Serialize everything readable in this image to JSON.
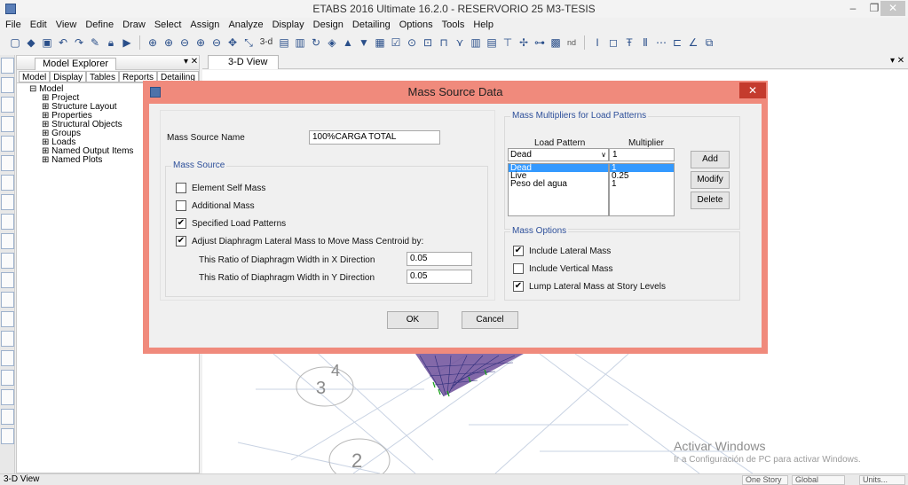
{
  "window": {
    "title": "ETABS 2016 Ultimate 16.2.0 - RESERVORIO 25 M3-TESIS",
    "minimize": "–",
    "maximize": "❐",
    "close": "✕"
  },
  "menu": [
    "File",
    "Edit",
    "View",
    "Define",
    "Draw",
    "Select",
    "Assign",
    "Analyze",
    "Display",
    "Design",
    "Detailing",
    "Options",
    "Tools",
    "Help"
  ],
  "toolbar": {
    "threed_label": "3-d",
    "nd_label": "nd"
  },
  "explorer": {
    "title": "Model Explorer",
    "pin": "▾ ✕",
    "tabs": [
      "Model",
      "Display",
      "Tables",
      "Reports",
      "Detailing"
    ],
    "tree": {
      "root": "Model",
      "children": [
        "Project",
        "Structure Layout",
        "Properties",
        "Structural Objects",
        "Groups",
        "Loads",
        "Named Output Items",
        "Named Plots"
      ]
    }
  },
  "view_tab": {
    "label": "3-D View",
    "controls": "▾ ✕"
  },
  "canvas": {
    "labels": [
      "3",
      "4",
      "2"
    ]
  },
  "dialog": {
    "title": "Mass Source Data",
    "close": "✕",
    "mass_source_name_label": "Mass Source Name",
    "mass_source_name_value": "100%CARGA TOTAL",
    "mass_source_group": "Mass Source",
    "element_self_mass": {
      "label": "Element Self Mass",
      "checked": false
    },
    "additional_mass": {
      "label": "Additional Mass",
      "checked": false
    },
    "specified_load_patterns": {
      "label": "Specified Load Patterns",
      "checked": true
    },
    "adjust_diaphragm": {
      "label": "Adjust Diaphragm Lateral Mass to Move Mass Centroid by:",
      "checked": true
    },
    "ratio_x_label": "This Ratio of Diaphragm Width in X Direction",
    "ratio_x_value": "0.05",
    "ratio_y_label": "This Ratio of Diaphragm Width in Y Direction",
    "ratio_y_value": "0.05",
    "multipliers_group": "Mass Multipliers for Load Patterns",
    "load_pattern_header": "Load Pattern",
    "multiplier_header": "Multiplier",
    "load_pattern_selected": "Dead",
    "multiplier_value": "1",
    "patterns": [
      "Dead",
      "Live",
      "Peso del agua"
    ],
    "multipliers": [
      "1",
      "0.25",
      "1"
    ],
    "add_button": "Add",
    "modify_button": "Modify",
    "delete_button": "Delete",
    "mass_options_group": "Mass Options",
    "include_lateral_mass": {
      "label": "Include Lateral Mass",
      "checked": true
    },
    "include_vertical_mass": {
      "label": "Include Vertical Mass",
      "checked": false
    },
    "lump_lateral_mass": {
      "label": "Lump Lateral Mass at Story Levels",
      "checked": true
    },
    "ok_button": "OK",
    "cancel_button": "Cancel"
  },
  "watermark": {
    "line1": "Activar Windows",
    "line2": "Ir a Configuración de PC para activar Windows."
  },
  "status": {
    "left": "3-D View",
    "story": "One Story",
    "global": "Global",
    "units": "Units..."
  }
}
